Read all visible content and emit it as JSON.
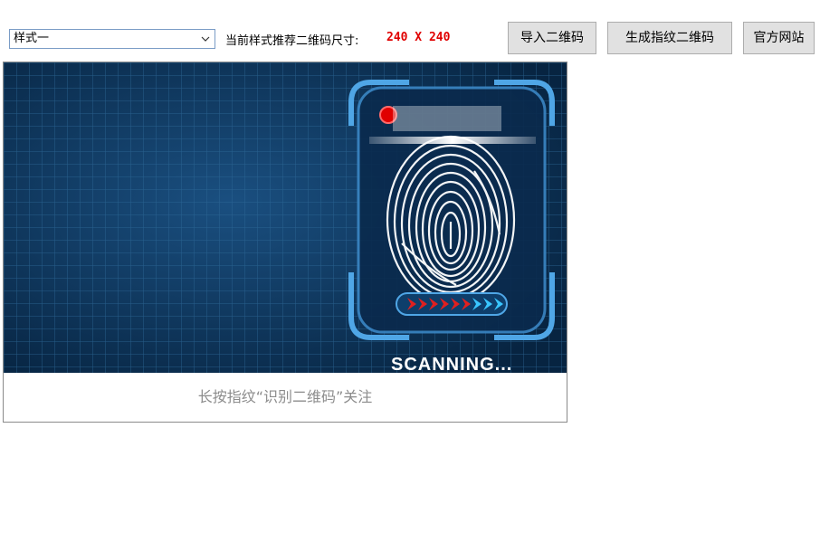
{
  "toolbar": {
    "style_select": {
      "selected": "样式一"
    },
    "size_label": "当前样式推荐二维码尺寸:",
    "size_value": "240 X 240",
    "buttons": {
      "import": "导入二维码",
      "generate": "生成指纹二维码",
      "site": "官方网站"
    }
  },
  "preview": {
    "banner_text": "SCANNING...",
    "caption": "长按指纹“识别二维码”关注"
  },
  "colors": {
    "background_dark": "#0b2f55",
    "grid_line": "#2f6b9a",
    "accent_red": "#e00000",
    "accent_cyan": "#39c6ff"
  }
}
